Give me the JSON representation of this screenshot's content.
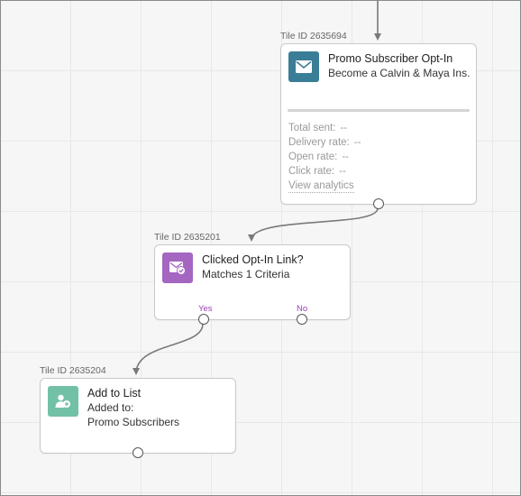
{
  "tiles": {
    "promo": {
      "id_label": "Tile ID 2635694",
      "title": "Promo Subscriber Opt-In",
      "subtitle": "Become a Calvin & Maya Ins...",
      "icon": "envelope-icon",
      "icon_color": "#3a7d96",
      "stats": {
        "total_sent_label": "Total sent:",
        "total_sent_value": "--",
        "delivery_rate_label": "Delivery rate:",
        "delivery_rate_value": "--",
        "open_rate_label": "Open rate:",
        "open_rate_value": "--",
        "click_rate_label": "Click rate:",
        "click_rate_value": "--",
        "view_analytics": "View analytics"
      }
    },
    "clicked": {
      "id_label": "Tile ID 2635201",
      "title": "Clicked Opt-In Link?",
      "matches_prefix": "Matches",
      "matches_link": "1 Criteria",
      "icon": "envelope-check-icon",
      "icon_color": "#a466c1",
      "yes_label": "Yes",
      "no_label": "No"
    },
    "addlist": {
      "id_label": "Tile ID 2635204",
      "title": "Add to List",
      "line1": "Added to:",
      "line2": "Promo Subscribers",
      "icon": "add-person-icon",
      "icon_color": "#72c1a7"
    }
  },
  "colors": {
    "connector": "#7a7a7a",
    "branch_label": "#9a3fb5"
  }
}
